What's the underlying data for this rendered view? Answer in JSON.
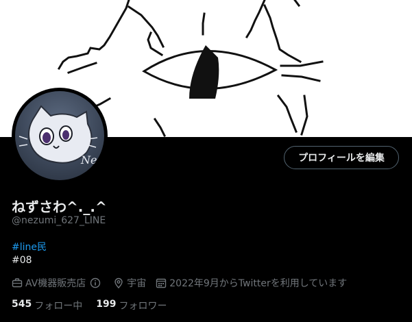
{
  "profile": {
    "display_name": "ねずさわ^._.^",
    "handle": "@nezumi_627_LINE",
    "edit_button_label": "プロフィールを編集",
    "avatar_signature": "Ne",
    "bio": {
      "hashtag": "#line民",
      "line2": "#08"
    },
    "meta": {
      "job": "AV機器販売店",
      "location": "宇宙",
      "joined": "2022年9月からTwitterを利用しています"
    },
    "stats": {
      "following_count": "545",
      "following_label": "フォロー中",
      "followers_count": "199",
      "followers_label": "フォロワー"
    }
  },
  "colors": {
    "background": "#000000",
    "text_primary": "#e7e9ea",
    "text_secondary": "#71767b",
    "link": "#1d9bf0",
    "button_border": "#536471",
    "banner_bg": "#ffffff"
  },
  "icons": [
    "briefcase-icon",
    "info-icon",
    "location-pin-icon",
    "calendar-icon"
  ]
}
